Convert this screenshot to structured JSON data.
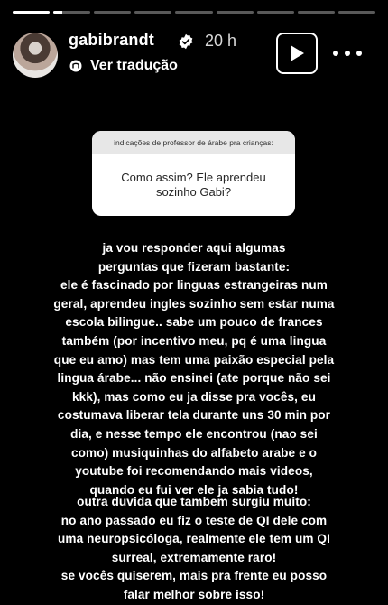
{
  "story": {
    "progress": [
      1.0,
      0.25,
      0,
      0,
      0,
      0,
      0,
      0,
      0
    ]
  },
  "header": {
    "username": "gabibrandt",
    "time": "20 h",
    "translate_label": "Ver tradução"
  },
  "question_box": {
    "header": "indicações de professor de árabe pra crianças:",
    "question": "Como assim? Ele aprendeu sozinho Gabi?"
  },
  "answer": {
    "paragraph1": [
      "ja vou responder aqui algumas",
      "perguntas que fizeram bastante:",
      "ele é fascinado por linguas estrangeiras num",
      "geral, aprendeu ingles sozinho sem estar numa",
      "escola bilingue.. sabe um pouco de frances",
      "também (por incentivo meu, pq é uma lingua",
      "que eu amo) mas tem uma paixão especial pela",
      "lingua árabe... não ensinei (ate porque não sei",
      "kkk), mas como eu ja disse pra vocês, eu",
      "costumava liberar tela durante uns 30 min por",
      "dia, e nesse tempo ele encontrou (nao sei",
      "como) musiquinhas do alfabeto arabe e o",
      "youtube foi recomendando mais videos,",
      "quando eu fui ver ele ja sabia tudo!"
    ],
    "paragraph2": [
      "outra duvida que tambem surgiu muito:",
      "no ano passado eu fiz o teste de QI dele com",
      "uma neuropsicóloga, realmente ele tem um QI",
      "surreal, extremamente raro!",
      "se vocês quiserem, mais pra frente eu posso",
      "falar melhor sobre isso!"
    ]
  }
}
